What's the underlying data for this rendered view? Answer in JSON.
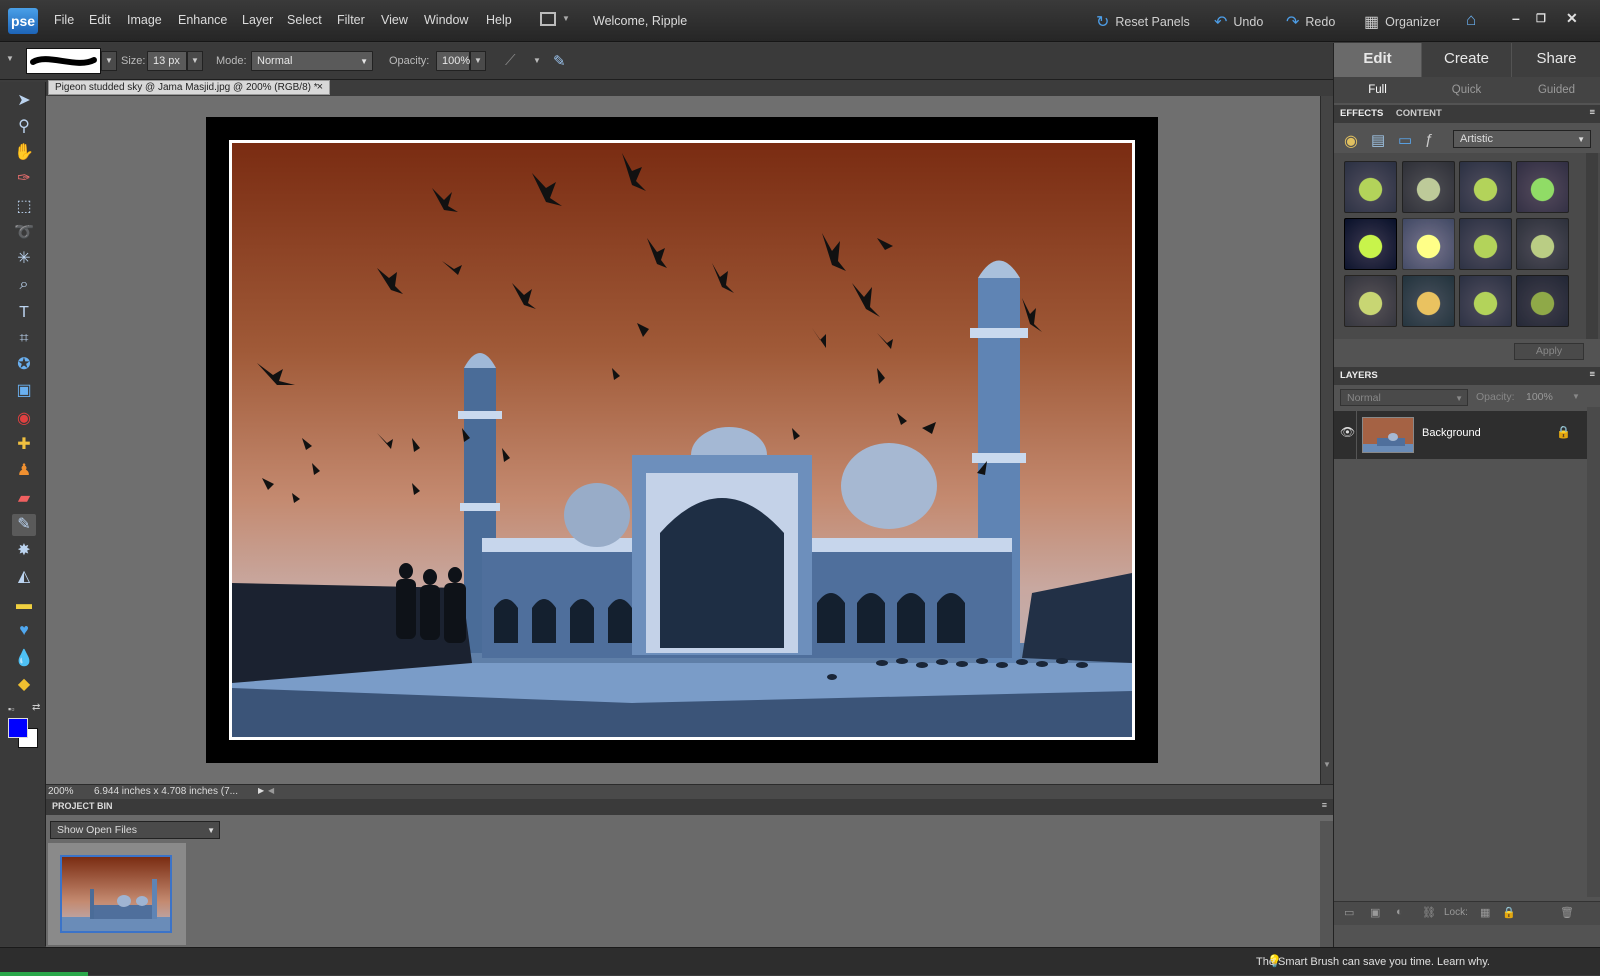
{
  "app": {
    "logo_text": "pse",
    "welcome": "Welcome, Ripple"
  },
  "menu": [
    "File",
    "Edit",
    "Image",
    "Enhance",
    "Layer",
    "Select",
    "Filter",
    "View",
    "Window",
    "Help"
  ],
  "top_actions": {
    "reset": "Reset Panels",
    "undo": "Undo",
    "redo": "Redo",
    "organizer": "Organizer"
  },
  "options": {
    "size_label": "Size:",
    "size_value": "13 px",
    "mode_label": "Mode:",
    "mode_value": "Normal",
    "opacity_label": "Opacity:",
    "opacity_value": "100%"
  },
  "document": {
    "tab_title": "Pigeon studded sky @ Jama Masjid.jpg @ 200% (RGB/8) *",
    "close": "×"
  },
  "status": {
    "zoom": "200%",
    "dimensions": "6.944 inches x 4.708 inches (7..."
  },
  "project_bin": {
    "title": "PROJECT BIN",
    "select_value": "Show Open Files"
  },
  "panel": {
    "tabs": [
      "Edit",
      "Create",
      "Share"
    ],
    "subtabs": [
      "Full",
      "Quick",
      "Guided"
    ],
    "effects_tab": "EFFECTS",
    "content_tab": "CONTENT",
    "effects_category": "Artistic",
    "apply": "Apply",
    "layers_title": "LAYERS",
    "blend_mode": "Normal",
    "layer_opacity_label": "Opacity:",
    "layer_opacity_value": "100%",
    "layer_name": "Background",
    "lock_label": "Lock:"
  },
  "hint": "The Smart Brush can save you time. Learn why.",
  "colors": {
    "accent": "#4d9ee8",
    "foreground": "#0000ff",
    "background": "#ffffff"
  }
}
